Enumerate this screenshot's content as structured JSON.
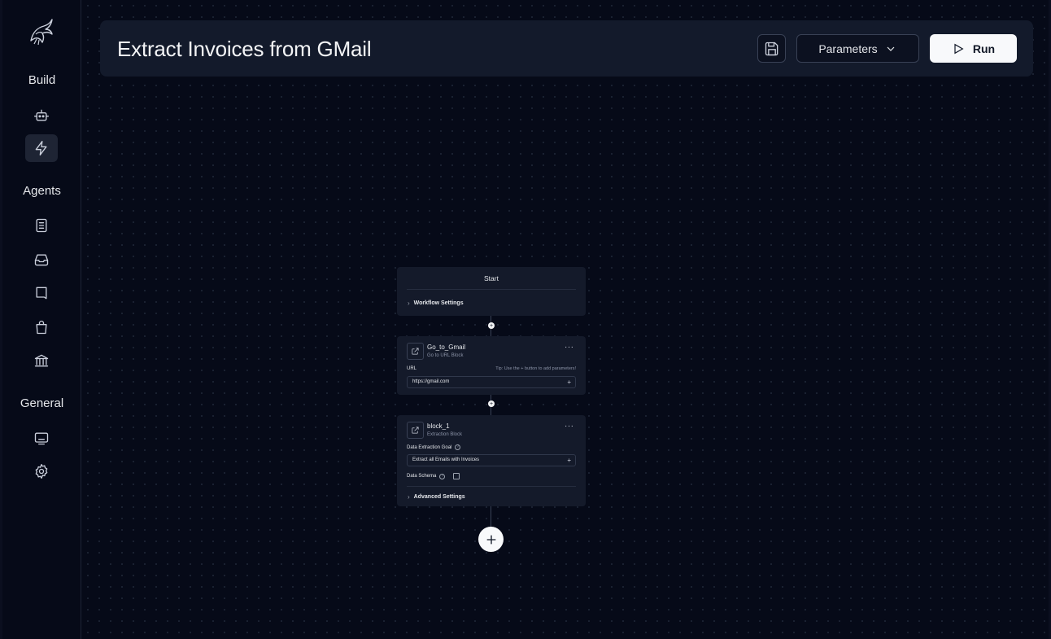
{
  "sidebar": {
    "headings": {
      "build": "Build",
      "agents": "Agents",
      "general": "General"
    },
    "build_items": [
      {
        "icon": "robot-icon"
      },
      {
        "icon": "lightning-icon",
        "active": true
      }
    ],
    "agents_items": [
      {
        "icon": "document-icon"
      },
      {
        "icon": "inbox-icon"
      },
      {
        "icon": "book-icon"
      },
      {
        "icon": "shopping-bag-icon"
      },
      {
        "icon": "bank-icon"
      }
    ],
    "general_items": [
      {
        "icon": "monitor-icon"
      },
      {
        "icon": "gear-icon"
      }
    ]
  },
  "header": {
    "title": "Extract Invoices from GMail",
    "parameters_label": "Parameters",
    "run_label": "Run"
  },
  "workflow": {
    "start": {
      "title": "Start",
      "settings_label": "Workflow Settings"
    },
    "blocks": [
      {
        "name": "Go_to_Gmail",
        "type": "Go to URL Block",
        "field_label": "URL",
        "tip": "Tip: Use the + button to add parameters!",
        "field_value": "https://gmail.com"
      },
      {
        "name": "block_1",
        "type": "Extraction Block",
        "goal_label": "Data Extraction Goal",
        "goal_value": "Extract all Emails with Invoices",
        "schema_label": "Data Schema",
        "advanced_label": "Advanced Settings"
      }
    ]
  },
  "colors": {
    "background": "#060a18",
    "panel": "#131a2b",
    "node": "#141a2a",
    "accent_button": "#f8f9fb"
  }
}
